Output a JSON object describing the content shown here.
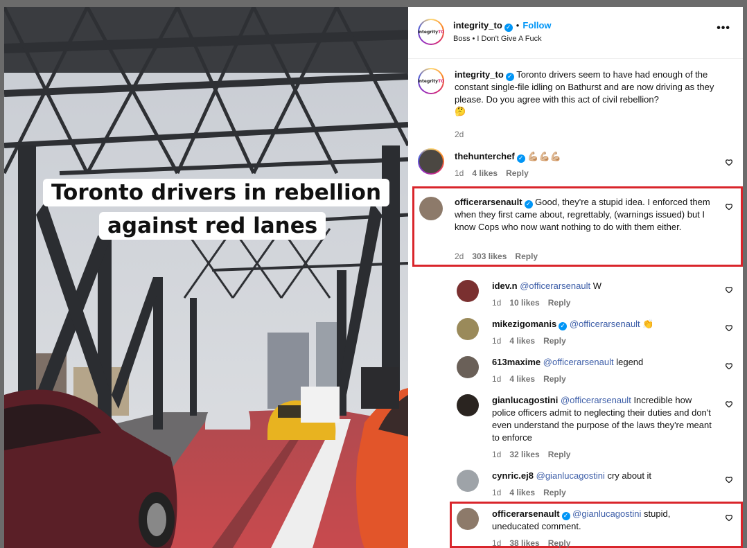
{
  "media": {
    "caption_line1": "Toronto drivers in rebellion",
    "caption_line2": "against red lanes"
  },
  "header": {
    "username": "integrity_to",
    "follow_label": "Follow",
    "audio": "Boss • I Don't Give A Fuck",
    "logo_text_a": "integrity",
    "logo_text_b": "TO"
  },
  "post": {
    "username": "integrity_to",
    "text": "Toronto drivers seem to have had enough of the constant single-file idling on Bathurst and are now driving as they please. Do you agree with this act of civil rebellion?",
    "emoji": "🤔",
    "time": "2d"
  },
  "comments": [
    {
      "username": "thehunterchef",
      "mention": "",
      "text": "💪🏼💪🏼💪🏼",
      "time": "1d",
      "likes": "4 likes",
      "reply": "Reply",
      "verified": true
    },
    {
      "username": "officerarsenault",
      "mention": "",
      "text": "Good, they're a stupid idea. I enforced them when they first came about, regrettably, (warnings issued) but I know Cops who now want nothing to do with them either.",
      "time": "2d",
      "likes": "303 likes",
      "reply": "Reply",
      "verified": true
    },
    {
      "username": "idev.n",
      "mention": "@officerarsenault",
      "text": "W",
      "time": "1d",
      "likes": "10 likes",
      "reply": "Reply",
      "verified": false
    },
    {
      "username": "mikezigomanis",
      "mention": "@officerarsenault",
      "text": "👏",
      "time": "1d",
      "likes": "4 likes",
      "reply": "Reply",
      "verified": true
    },
    {
      "username": "613maxime",
      "mention": "@officerarsenault",
      "text": "legend",
      "time": "1d",
      "likes": "4 likes",
      "reply": "Reply",
      "verified": false
    },
    {
      "username": "gianlucagostini",
      "mention": "@officerarsenault",
      "text": "Incredible how police officers admit to neglecting their duties and don't even understand the purpose of the laws they're meant to enforce",
      "time": "1d",
      "likes": "32 likes",
      "reply": "Reply",
      "verified": false
    },
    {
      "username": "cynric.ej8",
      "mention": "@gianlucagostini",
      "text": "cry about it",
      "time": "1d",
      "likes": "4 likes",
      "reply": "Reply",
      "verified": false
    },
    {
      "username": "officerarsenault",
      "mention": "@gianlucagostini",
      "text": "stupid, uneducated comment.",
      "time": "1d",
      "likes": "38 likes",
      "reply": "Reply",
      "verified": true
    }
  ],
  "colors": {
    "accent": "#0095f6",
    "highlight": "#d9252b",
    "mention": "#3d5ea8",
    "red_lane": "#c94a4a"
  }
}
